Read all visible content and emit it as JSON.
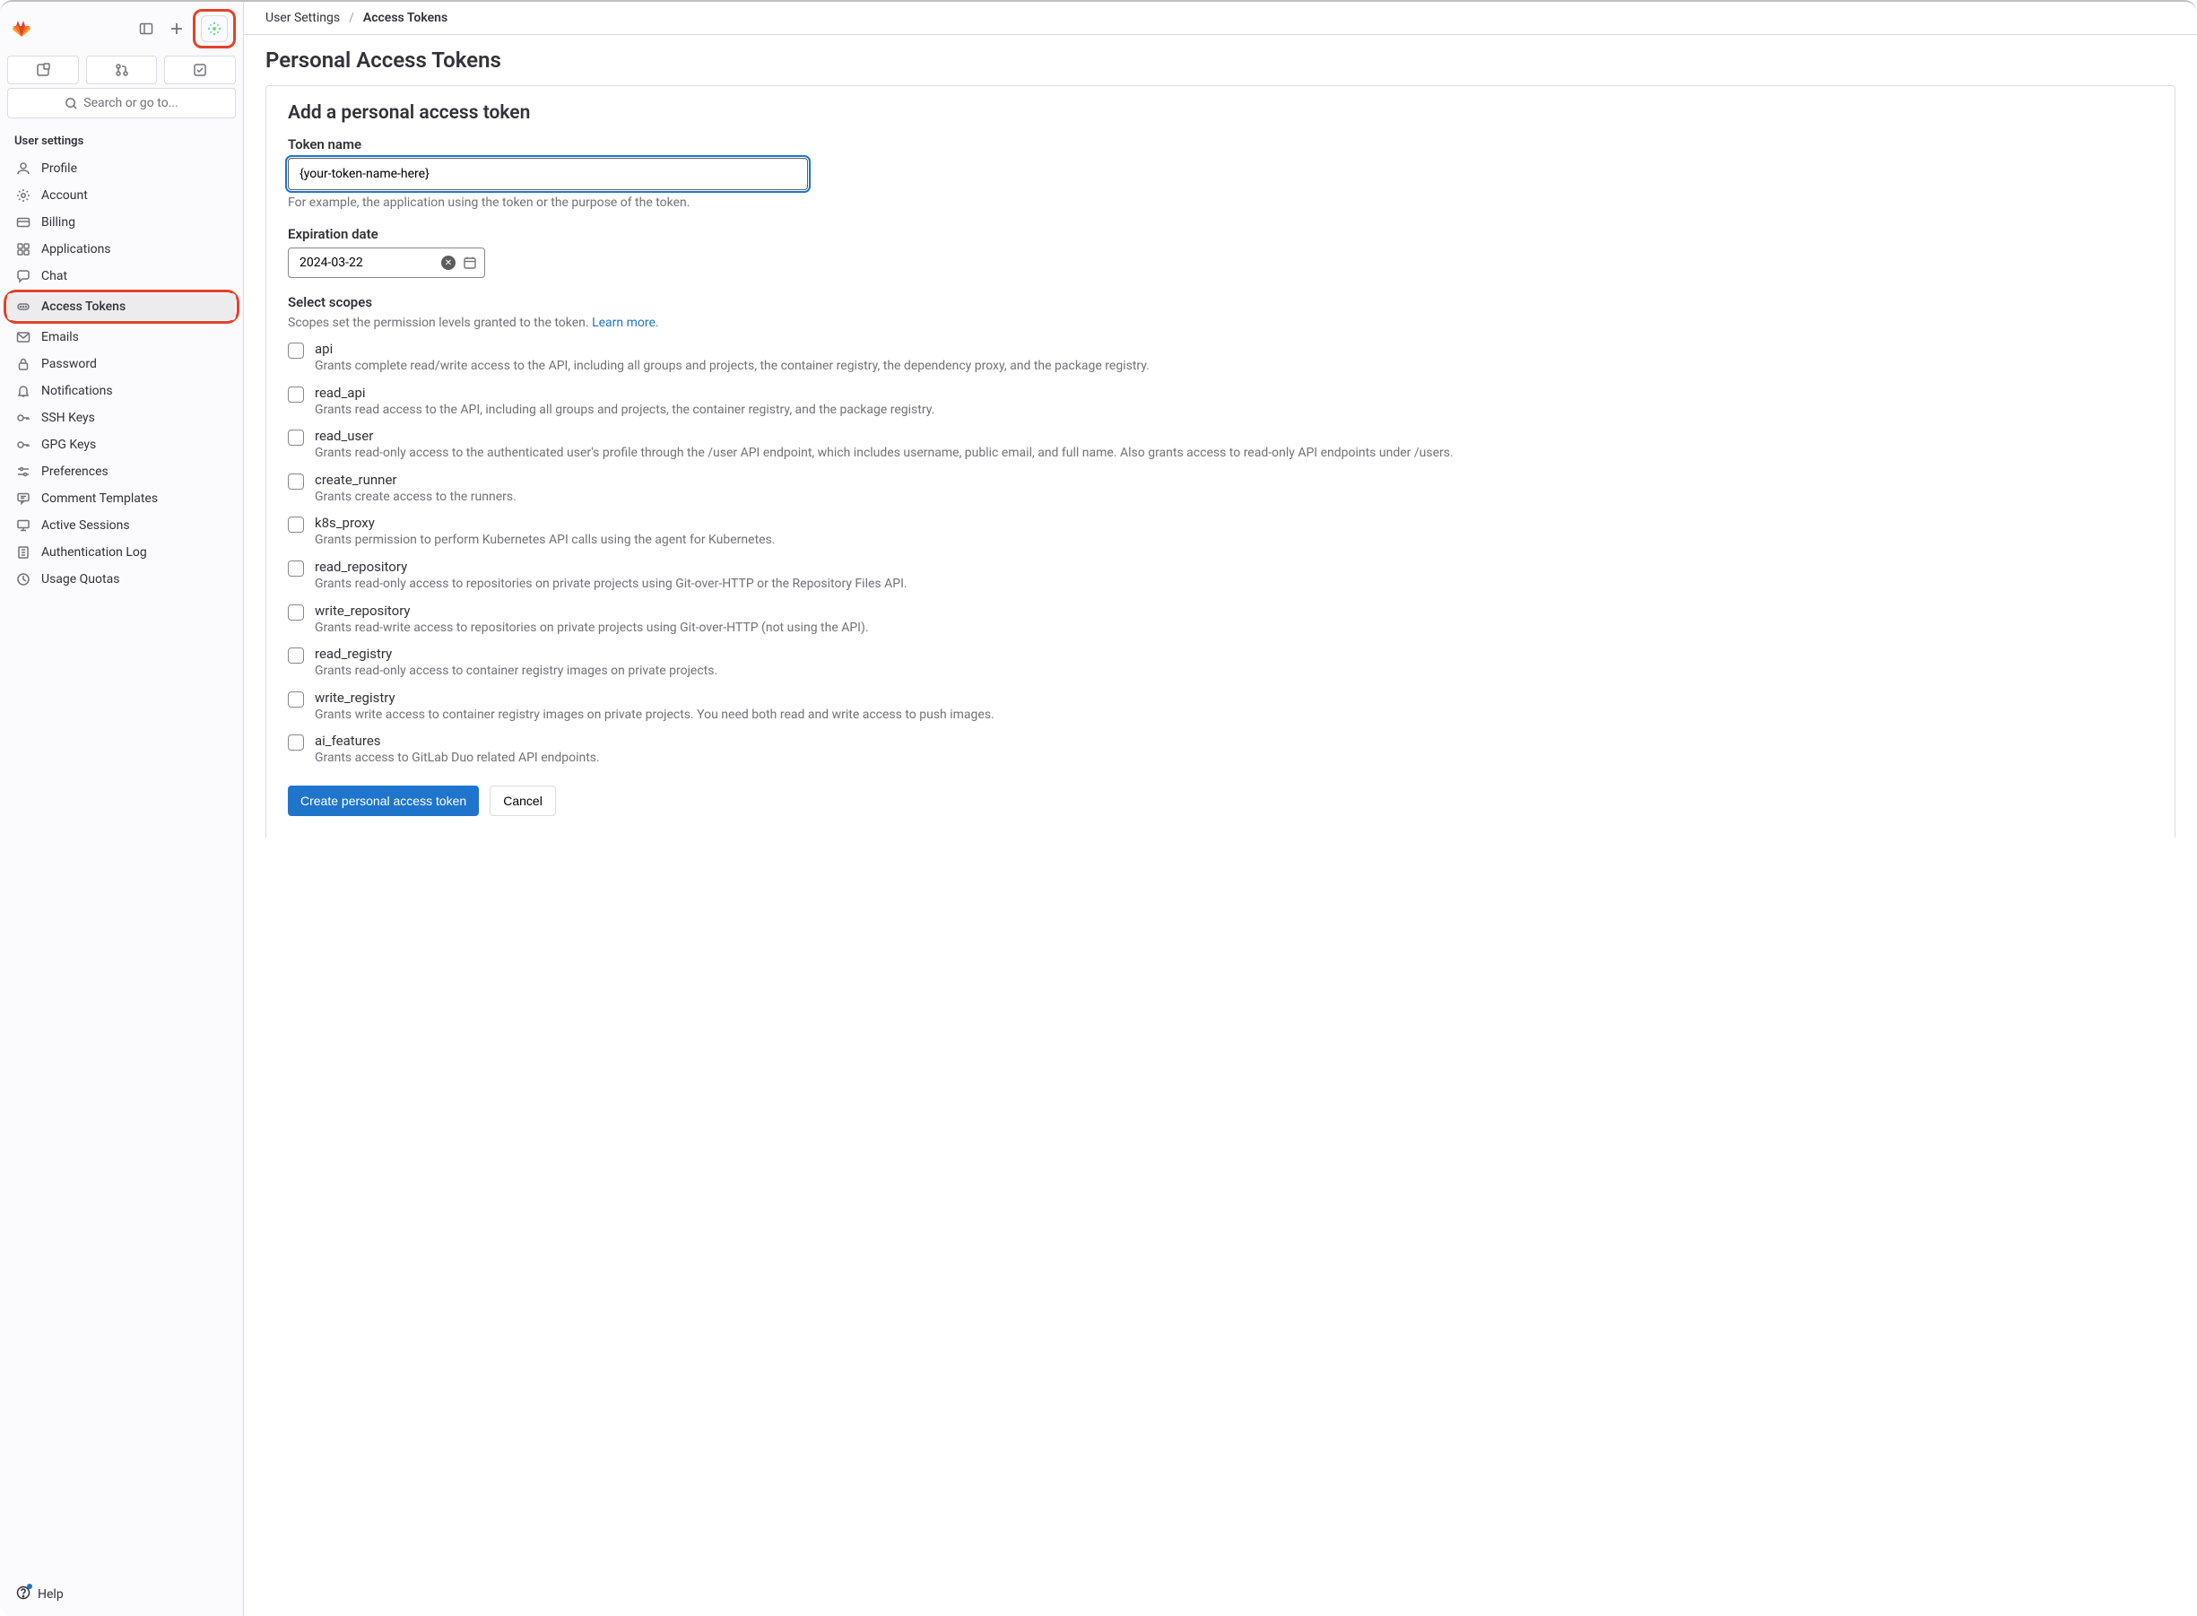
{
  "breadcrumb": {
    "parent": "User Settings",
    "current": "Access Tokens"
  },
  "page_title": "Personal Access Tokens",
  "search_placeholder": "Search or go to...",
  "help_label": "Help",
  "sidebar": {
    "section_label": "User settings",
    "items": [
      {
        "label": "Profile"
      },
      {
        "label": "Account"
      },
      {
        "label": "Billing"
      },
      {
        "label": "Applications"
      },
      {
        "label": "Chat"
      },
      {
        "label": "Access Tokens"
      },
      {
        "label": "Emails"
      },
      {
        "label": "Password"
      },
      {
        "label": "Notifications"
      },
      {
        "label": "SSH Keys"
      },
      {
        "label": "GPG Keys"
      },
      {
        "label": "Preferences"
      },
      {
        "label": "Comment Templates"
      },
      {
        "label": "Active Sessions"
      },
      {
        "label": "Authentication Log"
      },
      {
        "label": "Usage Quotas"
      }
    ]
  },
  "form": {
    "title": "Add a personal access token",
    "token_name_label": "Token name",
    "token_name_value": "{your-token-name-here}",
    "token_name_hint": "For example, the application using the token or the purpose of the token.",
    "expiration_label": "Expiration date",
    "expiration_value": "2024-03-22",
    "scopes_label": "Select scopes",
    "scopes_hint": "Scopes set the permission levels granted to the token. ",
    "scopes_learn_more": "Learn more.",
    "create_button": "Create personal access token",
    "cancel_button": "Cancel",
    "scopes": [
      {
        "name": "api",
        "desc": "Grants complete read/write access to the API, including all groups and projects, the container registry, the dependency proxy, and the package registry."
      },
      {
        "name": "read_api",
        "desc": "Grants read access to the API, including all groups and projects, the container registry, and the package registry."
      },
      {
        "name": "read_user",
        "desc": "Grants read-only access to the authenticated user's profile through the /user API endpoint, which includes username, public email, and full name. Also grants access to read-only API endpoints under /users."
      },
      {
        "name": "create_runner",
        "desc": "Grants create access to the runners."
      },
      {
        "name": "k8s_proxy",
        "desc": "Grants permission to perform Kubernetes API calls using the agent for Kubernetes."
      },
      {
        "name": "read_repository",
        "desc": "Grants read-only access to repositories on private projects using Git-over-HTTP or the Repository Files API."
      },
      {
        "name": "write_repository",
        "desc": "Grants read-write access to repositories on private projects using Git-over-HTTP (not using the API)."
      },
      {
        "name": "read_registry",
        "desc": "Grants read-only access to container registry images on private projects."
      },
      {
        "name": "write_registry",
        "desc": "Grants write access to container registry images on private projects. You need both read and write access to push images."
      },
      {
        "name": "ai_features",
        "desc": "Grants access to GitLab Duo related API endpoints."
      }
    ]
  }
}
